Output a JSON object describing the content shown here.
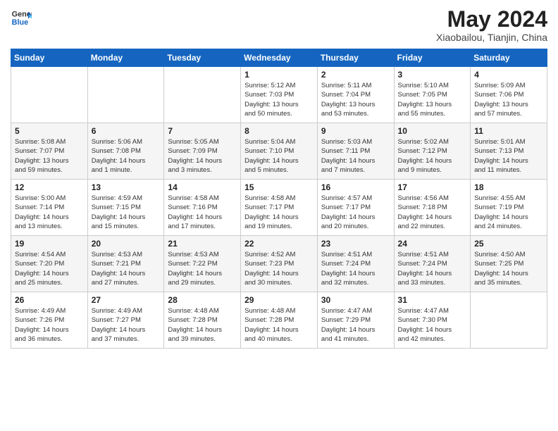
{
  "header": {
    "logo_line1": "General",
    "logo_line2": "Blue",
    "title": "May 2024",
    "subtitle": "Xiaobailou, Tianjin, China"
  },
  "weekdays": [
    "Sunday",
    "Monday",
    "Tuesday",
    "Wednesday",
    "Thursday",
    "Friday",
    "Saturday"
  ],
  "weeks": [
    [
      {
        "day": "",
        "info": ""
      },
      {
        "day": "",
        "info": ""
      },
      {
        "day": "",
        "info": ""
      },
      {
        "day": "1",
        "info": "Sunrise: 5:12 AM\nSunset: 7:03 PM\nDaylight: 13 hours\nand 50 minutes."
      },
      {
        "day": "2",
        "info": "Sunrise: 5:11 AM\nSunset: 7:04 PM\nDaylight: 13 hours\nand 53 minutes."
      },
      {
        "day": "3",
        "info": "Sunrise: 5:10 AM\nSunset: 7:05 PM\nDaylight: 13 hours\nand 55 minutes."
      },
      {
        "day": "4",
        "info": "Sunrise: 5:09 AM\nSunset: 7:06 PM\nDaylight: 13 hours\nand 57 minutes."
      }
    ],
    [
      {
        "day": "5",
        "info": "Sunrise: 5:08 AM\nSunset: 7:07 PM\nDaylight: 13 hours\nand 59 minutes."
      },
      {
        "day": "6",
        "info": "Sunrise: 5:06 AM\nSunset: 7:08 PM\nDaylight: 14 hours\nand 1 minute."
      },
      {
        "day": "7",
        "info": "Sunrise: 5:05 AM\nSunset: 7:09 PM\nDaylight: 14 hours\nand 3 minutes."
      },
      {
        "day": "8",
        "info": "Sunrise: 5:04 AM\nSunset: 7:10 PM\nDaylight: 14 hours\nand 5 minutes."
      },
      {
        "day": "9",
        "info": "Sunrise: 5:03 AM\nSunset: 7:11 PM\nDaylight: 14 hours\nand 7 minutes."
      },
      {
        "day": "10",
        "info": "Sunrise: 5:02 AM\nSunset: 7:12 PM\nDaylight: 14 hours\nand 9 minutes."
      },
      {
        "day": "11",
        "info": "Sunrise: 5:01 AM\nSunset: 7:13 PM\nDaylight: 14 hours\nand 11 minutes."
      }
    ],
    [
      {
        "day": "12",
        "info": "Sunrise: 5:00 AM\nSunset: 7:14 PM\nDaylight: 14 hours\nand 13 minutes."
      },
      {
        "day": "13",
        "info": "Sunrise: 4:59 AM\nSunset: 7:15 PM\nDaylight: 14 hours\nand 15 minutes."
      },
      {
        "day": "14",
        "info": "Sunrise: 4:58 AM\nSunset: 7:16 PM\nDaylight: 14 hours\nand 17 minutes."
      },
      {
        "day": "15",
        "info": "Sunrise: 4:58 AM\nSunset: 7:17 PM\nDaylight: 14 hours\nand 19 minutes."
      },
      {
        "day": "16",
        "info": "Sunrise: 4:57 AM\nSunset: 7:17 PM\nDaylight: 14 hours\nand 20 minutes."
      },
      {
        "day": "17",
        "info": "Sunrise: 4:56 AM\nSunset: 7:18 PM\nDaylight: 14 hours\nand 22 minutes."
      },
      {
        "day": "18",
        "info": "Sunrise: 4:55 AM\nSunset: 7:19 PM\nDaylight: 14 hours\nand 24 minutes."
      }
    ],
    [
      {
        "day": "19",
        "info": "Sunrise: 4:54 AM\nSunset: 7:20 PM\nDaylight: 14 hours\nand 25 minutes."
      },
      {
        "day": "20",
        "info": "Sunrise: 4:53 AM\nSunset: 7:21 PM\nDaylight: 14 hours\nand 27 minutes."
      },
      {
        "day": "21",
        "info": "Sunrise: 4:53 AM\nSunset: 7:22 PM\nDaylight: 14 hours\nand 29 minutes."
      },
      {
        "day": "22",
        "info": "Sunrise: 4:52 AM\nSunset: 7:23 PM\nDaylight: 14 hours\nand 30 minutes."
      },
      {
        "day": "23",
        "info": "Sunrise: 4:51 AM\nSunset: 7:24 PM\nDaylight: 14 hours\nand 32 minutes."
      },
      {
        "day": "24",
        "info": "Sunrise: 4:51 AM\nSunset: 7:24 PM\nDaylight: 14 hours\nand 33 minutes."
      },
      {
        "day": "25",
        "info": "Sunrise: 4:50 AM\nSunset: 7:25 PM\nDaylight: 14 hours\nand 35 minutes."
      }
    ],
    [
      {
        "day": "26",
        "info": "Sunrise: 4:49 AM\nSunset: 7:26 PM\nDaylight: 14 hours\nand 36 minutes."
      },
      {
        "day": "27",
        "info": "Sunrise: 4:49 AM\nSunset: 7:27 PM\nDaylight: 14 hours\nand 37 minutes."
      },
      {
        "day": "28",
        "info": "Sunrise: 4:48 AM\nSunset: 7:28 PM\nDaylight: 14 hours\nand 39 minutes."
      },
      {
        "day": "29",
        "info": "Sunrise: 4:48 AM\nSunset: 7:28 PM\nDaylight: 14 hours\nand 40 minutes."
      },
      {
        "day": "30",
        "info": "Sunrise: 4:47 AM\nSunset: 7:29 PM\nDaylight: 14 hours\nand 41 minutes."
      },
      {
        "day": "31",
        "info": "Sunrise: 4:47 AM\nSunset: 7:30 PM\nDaylight: 14 hours\nand 42 minutes."
      },
      {
        "day": "",
        "info": ""
      }
    ]
  ]
}
